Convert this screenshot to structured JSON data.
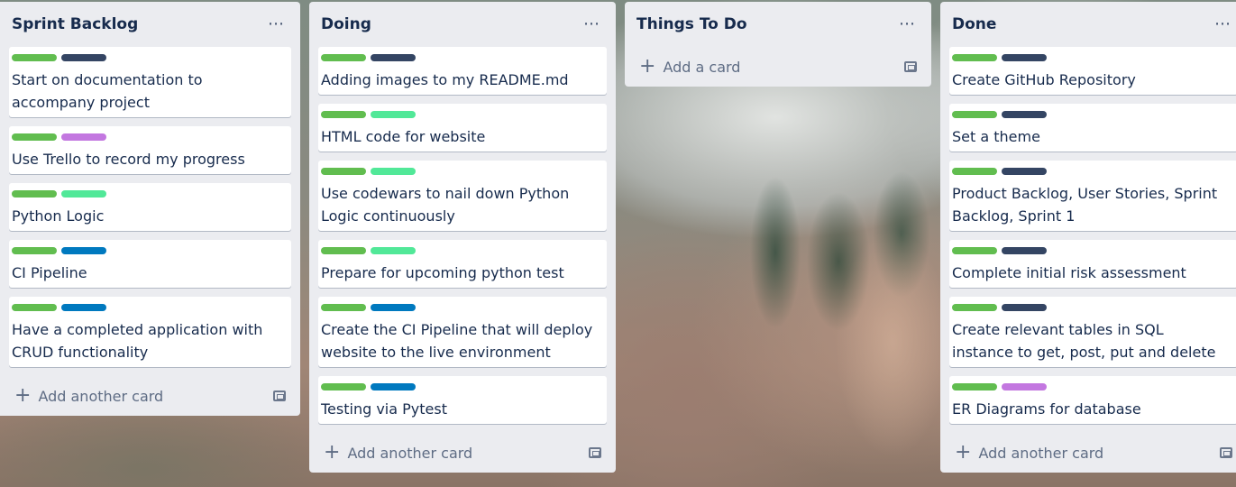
{
  "colors": {
    "green": "#61bd4f",
    "navy": "#344563",
    "purple": "#c377e0",
    "mint": "#51e898",
    "blue": "#0079bf"
  },
  "lists": [
    {
      "title": "Sprint Backlog",
      "add_label": "Add another card",
      "cards": [
        {
          "title": "Start on documentation to accompany project",
          "labels": [
            "green",
            "navy"
          ]
        },
        {
          "title": "Use Trello to record my progress",
          "labels": [
            "green",
            "purple"
          ]
        },
        {
          "title": "Python Logic",
          "labels": [
            "green",
            "mint"
          ]
        },
        {
          "title": "CI Pipeline",
          "labels": [
            "green",
            "blue"
          ]
        },
        {
          "title": "Have a completed application with CRUD functionality",
          "labels": [
            "green",
            "blue"
          ]
        }
      ]
    },
    {
      "title": "Doing",
      "add_label": "Add another card",
      "cards": [
        {
          "title": "Adding images to my README.md",
          "labels": [
            "green",
            "navy"
          ]
        },
        {
          "title": "HTML code for website",
          "labels": [
            "green",
            "mint"
          ]
        },
        {
          "title": "Use codewars to nail down Python Logic continuously",
          "labels": [
            "green",
            "mint"
          ]
        },
        {
          "title": "Prepare for upcoming python test",
          "labels": [
            "green",
            "mint"
          ]
        },
        {
          "title": "Create the CI Pipeline that will deploy website to the live environment",
          "labels": [
            "green",
            "blue"
          ]
        },
        {
          "title": "Testing via Pytest",
          "labels": [
            "green",
            "blue"
          ]
        }
      ]
    },
    {
      "title": "Things To Do",
      "add_label": "Add a card",
      "cards": []
    },
    {
      "title": "Done",
      "add_label": "Add another card",
      "cards": [
        {
          "title": "Create GitHub Repository",
          "labels": [
            "green",
            "navy"
          ]
        },
        {
          "title": "Set a theme",
          "labels": [
            "green",
            "navy"
          ]
        },
        {
          "title": "Product Backlog, User Stories, Sprint Backlog, Sprint 1",
          "labels": [
            "green",
            "navy"
          ]
        },
        {
          "title": "Complete initial risk assessment",
          "labels": [
            "green",
            "navy"
          ]
        },
        {
          "title": "Create relevant tables in SQL instance to get, post, put and delete",
          "labels": [
            "green",
            "navy"
          ]
        },
        {
          "title": "ER Diagrams for database",
          "labels": [
            "green",
            "purple"
          ]
        }
      ]
    }
  ]
}
